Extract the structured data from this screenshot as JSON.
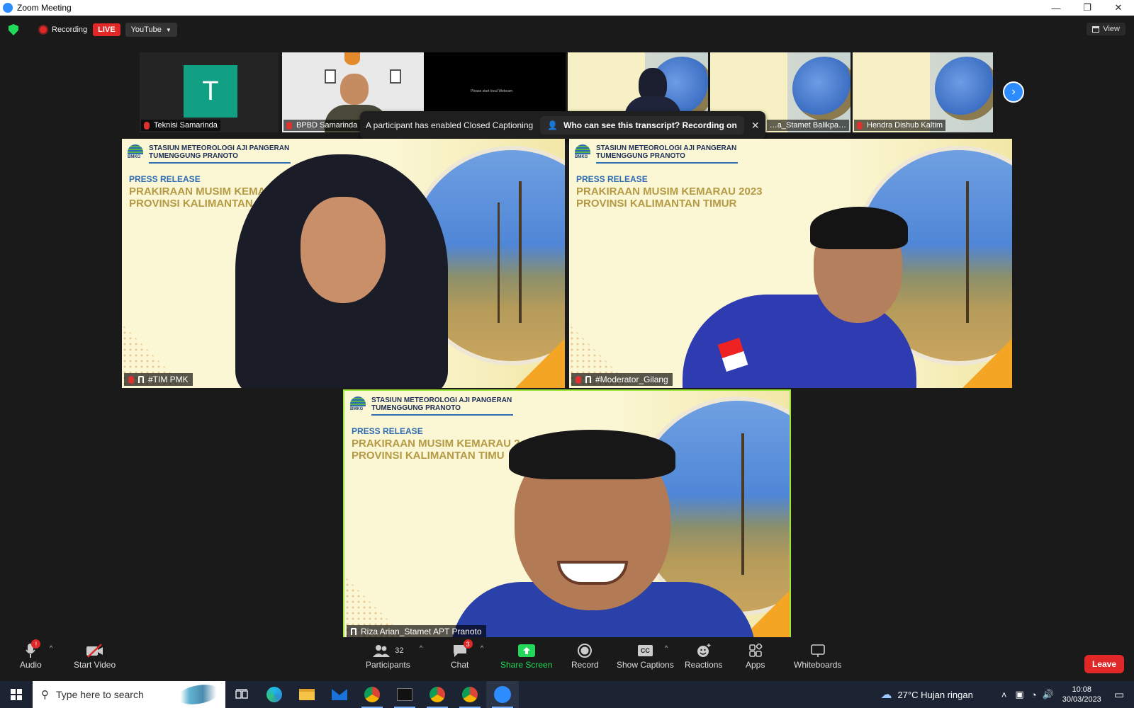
{
  "window": {
    "title": "Zoom Meeting",
    "minimize": "—",
    "restore": "❐",
    "close": "✕"
  },
  "topbar": {
    "recording_label": "Recording",
    "live_label": "LIVE",
    "stream_label": "YouTube",
    "view_label": "View"
  },
  "strip": [
    {
      "name": "Teknisi Samarinda",
      "avatar_letter": "T"
    },
    {
      "name": "BPBD Samarinda"
    },
    {
      "name": "",
      "screen_text": "Please start local Webcam"
    },
    {
      "name": ""
    },
    {
      "name": "…a_Stamet Balikpa…"
    },
    {
      "name": "Hendra Dishub Kaltim"
    }
  ],
  "notification": {
    "message": "A participant has enabled Closed Captioning",
    "transcript_label": "Who can see this transcript? Recording on",
    "close": "✕"
  },
  "slide": {
    "station_line1": "STASIUN METEOROLOGI AJI PANGERAN",
    "station_line2": "TUMENGGUNG PRANOTO",
    "logo_text": "BMKG",
    "press_release": "PRESS RELEASE",
    "title_line1": "PRAKIRAAN MUSIM KEMARAU 2023",
    "title_line2": "PROVINSI KALIMANTAN TIMUR",
    "title_line1_short": "PRAKIRAAN MUSIM KEMARAU",
    "title_line2_short": "PROVINSI KALIMANTAN TIM",
    "title_line1_bottom": "PRAKIRAAN MUSIM KEMARAU 2",
    "title_line2_bottom": "PROVINSI KALIMANTAN TIMU"
  },
  "videos": {
    "tile1_name": "#TIM PMK",
    "tile2_name": "#Moderator_Gilang",
    "tile3_name": "Riza Arian_Stamet APT Pranoto"
  },
  "toolbar": {
    "audio": "Audio",
    "audio_badge": "!",
    "start_video": "Start Video",
    "participants": "Participants",
    "participants_count": "32",
    "chat": "Chat",
    "chat_badge": "3",
    "share_screen": "Share Screen",
    "record": "Record",
    "show_captions": "Show Captions",
    "cc": "CC",
    "reactions": "Reactions",
    "apps": "Apps",
    "whiteboards": "Whiteboards",
    "leave": "Leave"
  },
  "taskbar": {
    "search_placeholder": "Type here to search",
    "weather": "27°C  Hujan ringan",
    "time": "10:08",
    "date": "30/03/2023"
  },
  "colors": {
    "accent": "#2d8cff",
    "danger": "#e02828",
    "share": "#23d959"
  }
}
